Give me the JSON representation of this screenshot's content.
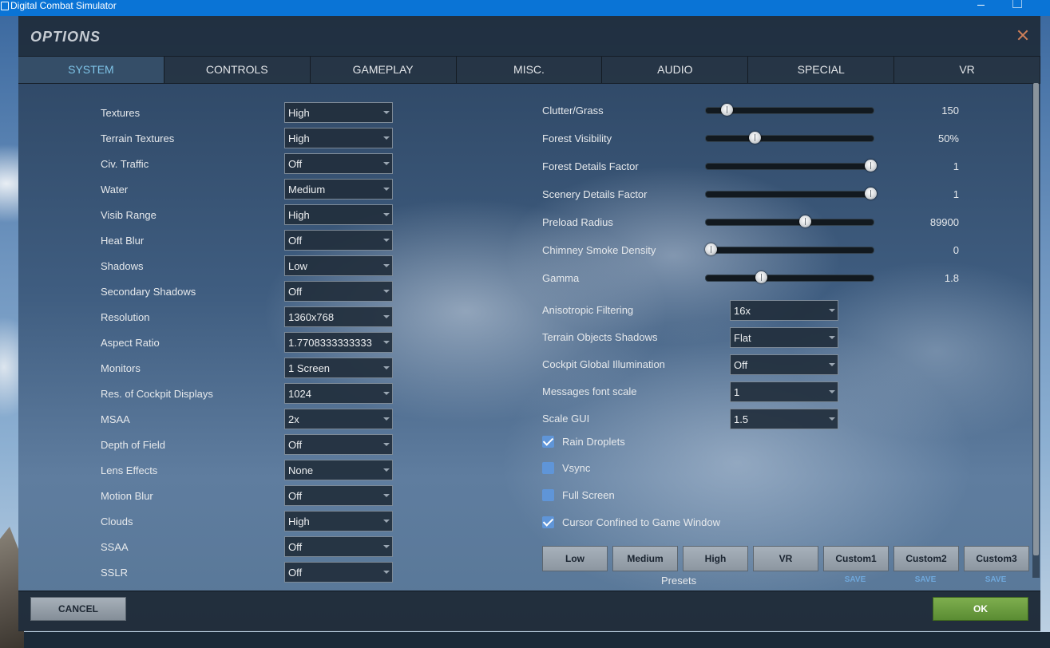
{
  "window": {
    "title": "Digital Combat Simulator"
  },
  "dialog": {
    "title": "OPTIONS"
  },
  "tabs": [
    {
      "label": "SYSTEM",
      "active": true
    },
    {
      "label": "CONTROLS",
      "active": false
    },
    {
      "label": "GAMEPLAY",
      "active": false
    },
    {
      "label": "MISC.",
      "active": false
    },
    {
      "label": "AUDIO",
      "active": false
    },
    {
      "label": "SPECIAL",
      "active": false
    },
    {
      "label": "VR",
      "active": false
    }
  ],
  "left_settings": [
    {
      "label": "Textures",
      "value": "High"
    },
    {
      "label": "Terrain Textures",
      "value": "High"
    },
    {
      "label": "Civ. Traffic",
      "value": "Off"
    },
    {
      "label": "Water",
      "value": "Medium"
    },
    {
      "label": "Visib Range",
      "value": "High"
    },
    {
      "label": "Heat Blur",
      "value": "Off"
    },
    {
      "label": "Shadows",
      "value": "Low"
    },
    {
      "label": "Secondary Shadows",
      "value": "Off"
    },
    {
      "label": "Resolution",
      "value": "1360x768"
    },
    {
      "label": "Aspect Ratio",
      "value": "1.7708333333333"
    },
    {
      "label": "Monitors",
      "value": "1 Screen"
    },
    {
      "label": "Res. of Cockpit Displays",
      "value": "1024"
    },
    {
      "label": "MSAA",
      "value": "2x"
    },
    {
      "label": "Depth of Field",
      "value": "Off"
    },
    {
      "label": "Lens Effects",
      "value": "None"
    },
    {
      "label": "Motion Blur",
      "value": "Off"
    },
    {
      "label": "Clouds",
      "value": "High"
    },
    {
      "label": "SSAA",
      "value": "Off"
    },
    {
      "label": "SSLR",
      "value": "Off"
    }
  ],
  "sliders": [
    {
      "label": "Clutter/Grass",
      "value": "150",
      "fraction": 0.12
    },
    {
      "label": "Forest Visibility",
      "value": "50%",
      "fraction": 0.29
    },
    {
      "label": "Forest Details Factor",
      "value": "1",
      "fraction": 1.0
    },
    {
      "label": "Scenery Details Factor",
      "value": "1",
      "fraction": 1.0
    },
    {
      "label": "Preload Radius",
      "value": "89900",
      "fraction": 0.6
    },
    {
      "label": "Chimney Smoke Density",
      "value": "0",
      "fraction": 0.02
    },
    {
      "label": "Gamma",
      "value": "1.8",
      "fraction": 0.33
    }
  ],
  "right_selects": [
    {
      "label": "Anisotropic Filtering",
      "value": "16x"
    },
    {
      "label": "Terrain Objects Shadows",
      "value": "Flat"
    },
    {
      "label": "Cockpit Global Illumination",
      "value": "Off"
    },
    {
      "label": "Messages font scale",
      "value": "1"
    },
    {
      "label": "Scale GUI",
      "value": "1.5"
    }
  ],
  "checkboxes": [
    {
      "label": "Rain Droplets",
      "checked": true
    },
    {
      "label": "Vsync",
      "checked": false
    },
    {
      "label": "Full Screen",
      "checked": false
    },
    {
      "label": "Cursor Confined to Game Window",
      "checked": true
    }
  ],
  "presets": {
    "label": "Presets",
    "buttons": [
      "Low",
      "Medium",
      "High",
      "VR",
      "Custom1",
      "Custom2",
      "Custom3"
    ],
    "save_label": "SAVE"
  },
  "footer": {
    "cancel_label": "CANCEL",
    "ok_label": "OK"
  },
  "colors": {
    "accent_tab": "#7fc4e8",
    "ok_green": "#5a8c33",
    "checkbox_blue": "#5f95d8",
    "close_x": "#d0805a"
  }
}
